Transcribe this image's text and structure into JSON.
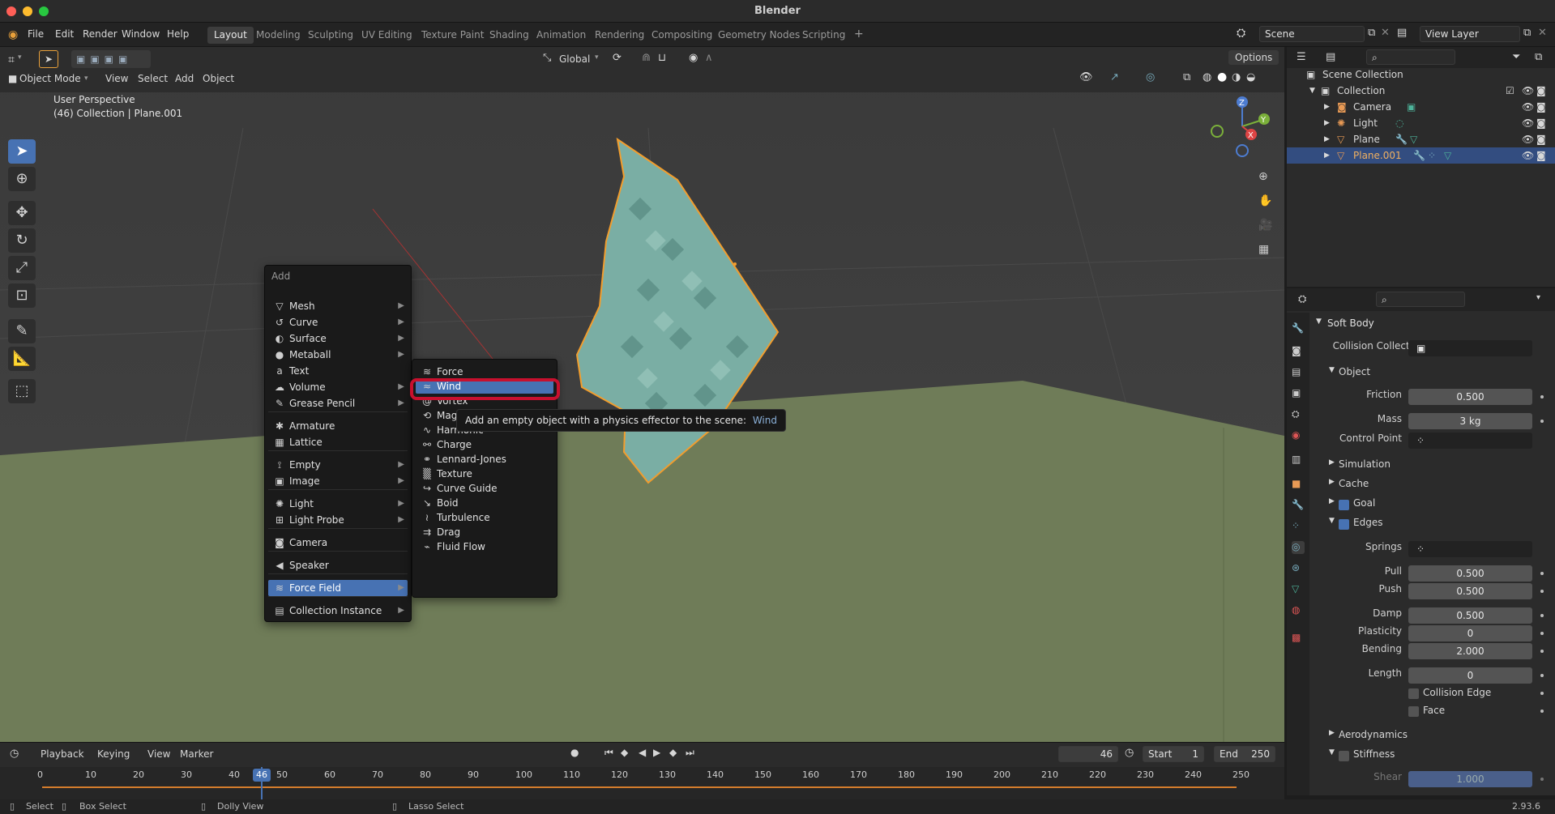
{
  "app": {
    "title": "Blender",
    "version": "2.93.6"
  },
  "menubar": [
    "File",
    "Edit",
    "Render",
    "Window",
    "Help"
  ],
  "workspaces": {
    "active": "Layout",
    "tabs": [
      "Layout",
      "Modeling",
      "Sculpting",
      "UV Editing",
      "Texture Paint",
      "Shading",
      "Animation",
      "Rendering",
      "Compositing",
      "Geometry Nodes",
      "Scripting"
    ]
  },
  "scene_field": "Scene",
  "view_layer_field": "View Layer",
  "tool_header": {
    "orientation": "Global",
    "options": "Options"
  },
  "viewport_header": {
    "mode": "Object Mode",
    "menus": [
      "View",
      "Select",
      "Add",
      "Object"
    ]
  },
  "viewport": {
    "perspective": "User Perspective",
    "context": "(46) Collection | Plane.001"
  },
  "add_menu": {
    "title": "Add",
    "items": [
      {
        "label": "Mesh",
        "icon": "mesh-icon",
        "glyph": "▽",
        "sub": true
      },
      {
        "label": "Curve",
        "icon": "curve-icon",
        "glyph": "↺",
        "sub": true
      },
      {
        "label": "Surface",
        "icon": "surface-icon",
        "glyph": "◐",
        "sub": true
      },
      {
        "label": "Metaball",
        "icon": "metaball-icon",
        "glyph": "●",
        "sub": true
      },
      {
        "label": "Text",
        "icon": "text-icon",
        "glyph": "a",
        "sub": false
      },
      {
        "label": "Volume",
        "icon": "volume-icon",
        "glyph": "☁",
        "sub": true
      },
      {
        "label": "Grease Pencil",
        "icon": "grease-pencil-icon",
        "glyph": "✎",
        "sub": true
      },
      {
        "label": "Armature",
        "icon": "armature-icon",
        "glyph": "✱",
        "sub": false
      },
      {
        "label": "Lattice",
        "icon": "lattice-icon",
        "glyph": "▦",
        "sub": false
      },
      {
        "label": "Empty",
        "icon": "empty-icon",
        "glyph": "⟟",
        "sub": true
      },
      {
        "label": "Image",
        "icon": "image-icon",
        "glyph": "▣",
        "sub": true
      },
      {
        "label": "Light",
        "icon": "light-icon",
        "glyph": "✺",
        "sub": true
      },
      {
        "label": "Light Probe",
        "icon": "light-probe-icon",
        "glyph": "⊞",
        "sub": true
      },
      {
        "label": "Camera",
        "icon": "camera-icon",
        "glyph": "◙",
        "sub": false
      },
      {
        "label": "Speaker",
        "icon": "speaker-icon",
        "glyph": "◀",
        "sub": false
      },
      {
        "label": "Force Field",
        "icon": "force-field-icon",
        "glyph": "≋",
        "sub": true,
        "highlighted": true
      },
      {
        "label": "Collection Instance",
        "icon": "collection-instance-icon",
        "glyph": "▤",
        "sub": true
      }
    ]
  },
  "force_field_menu": {
    "items": [
      {
        "label": "Force",
        "icon": "force-icon",
        "glyph": "≋"
      },
      {
        "label": "Wind",
        "icon": "wind-icon",
        "glyph": "≈",
        "highlighted": true
      },
      {
        "label": "Vortex",
        "icon": "vortex-icon",
        "glyph": "@"
      },
      {
        "label": "Magnetic",
        "icon": "magnetic-icon",
        "glyph": "⟲"
      },
      {
        "label": "Harmonic",
        "icon": "harmonic-icon",
        "glyph": "∿"
      },
      {
        "label": "Charge",
        "icon": "charge-icon",
        "glyph": "⚯"
      },
      {
        "label": "Lennard-Jones",
        "icon": "lennard-jones-icon",
        "glyph": "⚭"
      },
      {
        "label": "Texture",
        "icon": "texture-icon",
        "glyph": "▒"
      },
      {
        "label": "Curve Guide",
        "icon": "curve-guide-icon",
        "glyph": "↪"
      },
      {
        "label": "Boid",
        "icon": "boid-icon",
        "glyph": "↘"
      },
      {
        "label": "Turbulence",
        "icon": "turbulence-icon",
        "glyph": "≀"
      },
      {
        "label": "Drag",
        "icon": "drag-icon",
        "glyph": "⇉"
      },
      {
        "label": "Fluid Flow",
        "icon": "fluid-flow-icon",
        "glyph": "⌁"
      }
    ]
  },
  "tooltip": {
    "text": "Add an empty object with a physics effector to the scene:",
    "op": "Wind"
  },
  "outliner": {
    "root": "Scene Collection",
    "collection": "Collection",
    "objects": [
      "Camera",
      "Light",
      "Plane",
      "Plane.001"
    ],
    "selected": "Plane.001"
  },
  "properties": {
    "panel": "Soft Body",
    "collision_collection_label": "Collision Collection",
    "object_section": "Object",
    "friction_label": "Friction",
    "friction": "0.500",
    "mass_label": "Mass",
    "mass": "3 kg",
    "control_point_label": "Control Point",
    "simulation": "Simulation",
    "cache": "Cache",
    "goal": "Goal",
    "edges": "Edges",
    "springs_label": "Springs",
    "pull_label": "Pull",
    "pull": "0.500",
    "push_label": "Push",
    "push": "0.500",
    "damp_label": "Damp",
    "damp": "0.500",
    "plasticity_label": "Plasticity",
    "plasticity": "0",
    "bending_label": "Bending",
    "bending": "2.000",
    "length_label": "Length",
    "length": "0",
    "collision_edge": "Collision Edge",
    "face": "Face",
    "aerodynamics": "Aerodynamics",
    "stiffness": "Stiffness",
    "shear_label": "Shear",
    "shear": "1.000"
  },
  "timeline": {
    "menus": [
      "Playback",
      "Keying",
      "View",
      "Marker"
    ],
    "current_frame": "46",
    "start_label": "Start",
    "start": "1",
    "end_label": "End",
    "end": "250",
    "ticks": [
      "0",
      "10",
      "20",
      "30",
      "40",
      "50",
      "60",
      "70",
      "80",
      "90",
      "100",
      "110",
      "120",
      "130",
      "140",
      "150",
      "160",
      "170",
      "180",
      "190",
      "200",
      "210",
      "220",
      "230",
      "240",
      "250"
    ]
  },
  "statusbar": {
    "select": "Select",
    "box_select": "Box Select",
    "dolly_view": "Dolly View",
    "lasso_select": "Lasso Select"
  },
  "colors": {
    "accent": "#4772b3",
    "highlight_outline": "#c8102e",
    "selection_orange": "#f29d2d",
    "ground": "#6f7c58"
  }
}
